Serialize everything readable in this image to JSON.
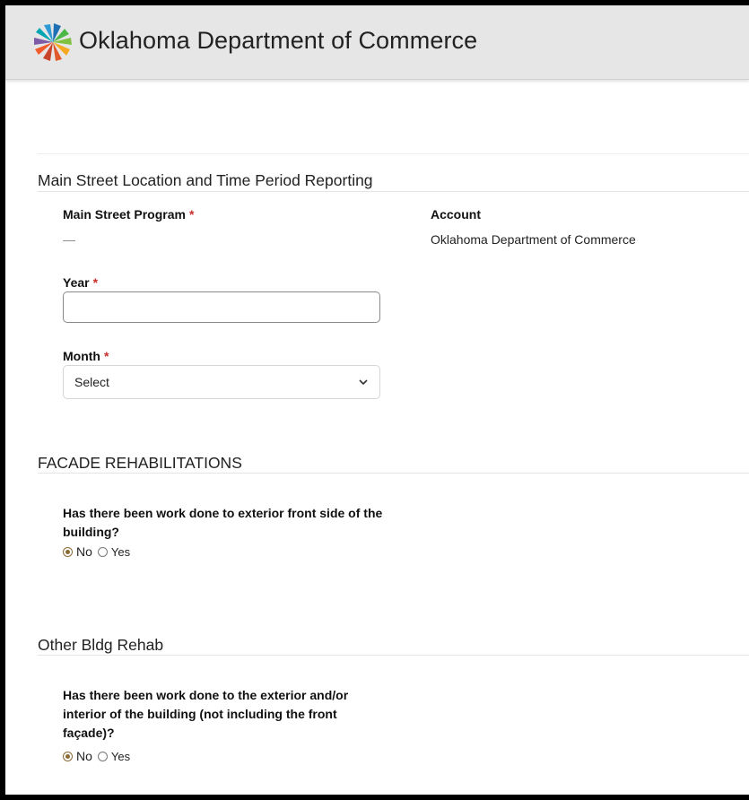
{
  "header": {
    "title": "Oklahoma Department of Commerce",
    "logo_icon": "oklahoma-commerce-logo-icon"
  },
  "location_section": {
    "title": "Main Street Location and Time Period Reporting",
    "program": {
      "label": "Main Street Program",
      "required_mark": "*",
      "value": "—"
    },
    "account": {
      "label": "Account",
      "value": "Oklahoma Department of Commerce"
    },
    "year": {
      "label": "Year",
      "required_mark": "*",
      "value": ""
    },
    "month": {
      "label": "Month",
      "required_mark": "*",
      "selected": "Select"
    }
  },
  "facade_section": {
    "title": "FACADE REHABILITATIONS",
    "question": "Has there been work done to exterior front side of the building?",
    "options": [
      "No",
      "Yes"
    ],
    "selected": "No"
  },
  "other_section": {
    "title": "Other Bldg Rehab",
    "question": "Has there been work done to the exterior and/or interior of the building (not including the front façade)?",
    "options": [
      "No",
      "Yes"
    ],
    "selected": "No"
  },
  "colors": {
    "header_bg": "#e6e6e6",
    "required": "#c9302c",
    "radio_checked": "#8a6a33"
  }
}
